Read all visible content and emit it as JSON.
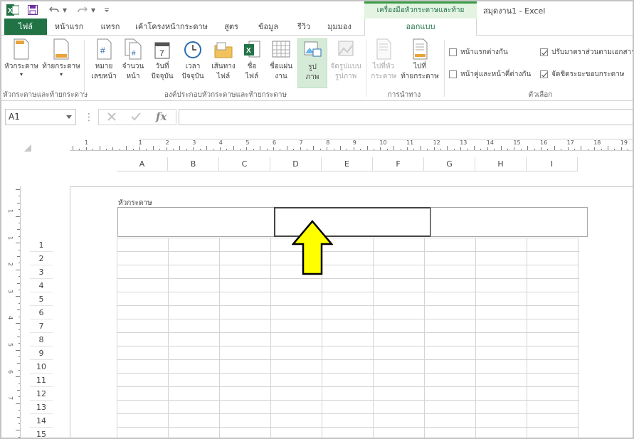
{
  "window": {
    "title": "สมุดงาน1 - Excel",
    "contextual_title": "เครื่องมือหัวกระดาษและท้ายกระดาษ"
  },
  "tabs": {
    "file": "ไฟล์",
    "home": "หน้าแรก",
    "insert": "แทรก",
    "page_layout": "เค้าโครงหน้ากระดาษ",
    "formulas": "สูตร",
    "data": "ข้อมูล",
    "review": "รีวิว",
    "view": "มุมมอง",
    "design": "ออกแบบ"
  },
  "ribbon": {
    "header": "หัวกระดาษ",
    "footer": "ท้ายกระดาษ",
    "page_number_1": "หมาย",
    "page_number_2": "เลขหน้า",
    "num_pages_1": "จำนวน",
    "num_pages_2": "หน้า",
    "current_date_1": "วันที่",
    "current_date_2": "ปัจจุบัน",
    "current_time_1": "เวลา",
    "current_time_2": "ปัจจุบัน",
    "file_path_1": "เส้นทาง",
    "file_path_2": "ไฟล์",
    "file_name_1": "ชื่อ",
    "file_name_2": "ไฟล์",
    "sheet_name_1": "ชื่อแผ่น",
    "sheet_name_2": "งาน",
    "picture_1": "รูป",
    "picture_2": "ภาพ",
    "format_picture_1": "จัดรูปแบบ",
    "format_picture_2": "รูปภาพ",
    "goto_header_1": "ไปที่หัว",
    "goto_header_2": "กระดาษ",
    "goto_footer_1": "ไปที่",
    "goto_footer_2": "ท้ายกระดาษ",
    "groups": {
      "header_footer": "หัวกระดาษและท้ายกระดาษ",
      "elements": "องค์ประกอบหัวกระดาษและท้ายกระดาษ",
      "navigation": "การนำทาง",
      "options": "ตัวเลือก"
    },
    "options": {
      "different_first_page": "หน้าแรกต่างกัน",
      "different_odd_even": "หน้าคู่และหน้าคี่ต่างกัน",
      "scale_with_document": "ปรับมาตราส่วนตามเอกสาร",
      "align_with_margins": "จัดชิดระยะขอบกระดาษ"
    }
  },
  "formula_bar": {
    "name_box": "A1",
    "fx": "fx"
  },
  "sheet": {
    "header_label": "หัวกระดาษ",
    "columns": [
      "A",
      "B",
      "C",
      "D",
      "E",
      "F",
      "G",
      "H",
      "I"
    ],
    "rows": [
      "1",
      "2",
      "3",
      "4",
      "5",
      "6",
      "7",
      "8",
      "9",
      "10",
      "11",
      "12",
      "13",
      "14",
      "15"
    ],
    "hruler_numbers": [
      "1",
      "1",
      "2",
      "3",
      "4",
      "5",
      "6",
      "7",
      "8",
      "9",
      "10",
      "11",
      "12",
      "13",
      "14",
      "15",
      "16",
      "17",
      "18",
      "19"
    ],
    "vruler_numbers": [
      "1",
      "1",
      "2",
      "3",
      "4",
      "5",
      "6",
      "7"
    ]
  },
  "colors": {
    "excel_green": "#217346",
    "highlight_arrow": "#ffff00",
    "active_button": "#d5ebd7"
  }
}
